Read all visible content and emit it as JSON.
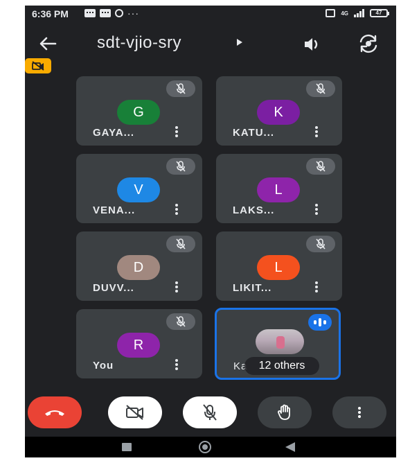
{
  "status_bar": {
    "time": "6:36 PM",
    "network": "4G",
    "battery": "47"
  },
  "header": {
    "meeting_code": "sdt-vjio-sry"
  },
  "participants": [
    {
      "initial": "G",
      "name": "GAYA...",
      "color": "#188038"
    },
    {
      "initial": "K",
      "name": "KATU...",
      "color": "#7b1fa2"
    },
    {
      "initial": "V",
      "name": "VENA...",
      "color": "#1e88e5"
    },
    {
      "initial": "L",
      "name": "LAKS...",
      "color": "#8e24aa"
    },
    {
      "initial": "D",
      "name": "DUVV...",
      "color": "#a1887f"
    },
    {
      "initial": "L",
      "name": "LIKIT...",
      "color": "#f4511e"
    },
    {
      "initial": "R",
      "name": "You",
      "color": "#8e24aa"
    }
  ],
  "others_tile": {
    "name": "Ka",
    "others_label": "12 others"
  },
  "colors": {
    "accent": "#1a73e8",
    "end_call": "#ea4335",
    "recording": "#f9ab00"
  },
  "icons": [
    "back-arrow-icon",
    "play-caret-icon",
    "speaker-icon",
    "switch-camera-icon",
    "recording-off-icon",
    "mic-off-icon",
    "more-vert-icon",
    "audio-levels-icon",
    "end-call-icon",
    "camera-off-icon",
    "raise-hand-icon"
  ]
}
